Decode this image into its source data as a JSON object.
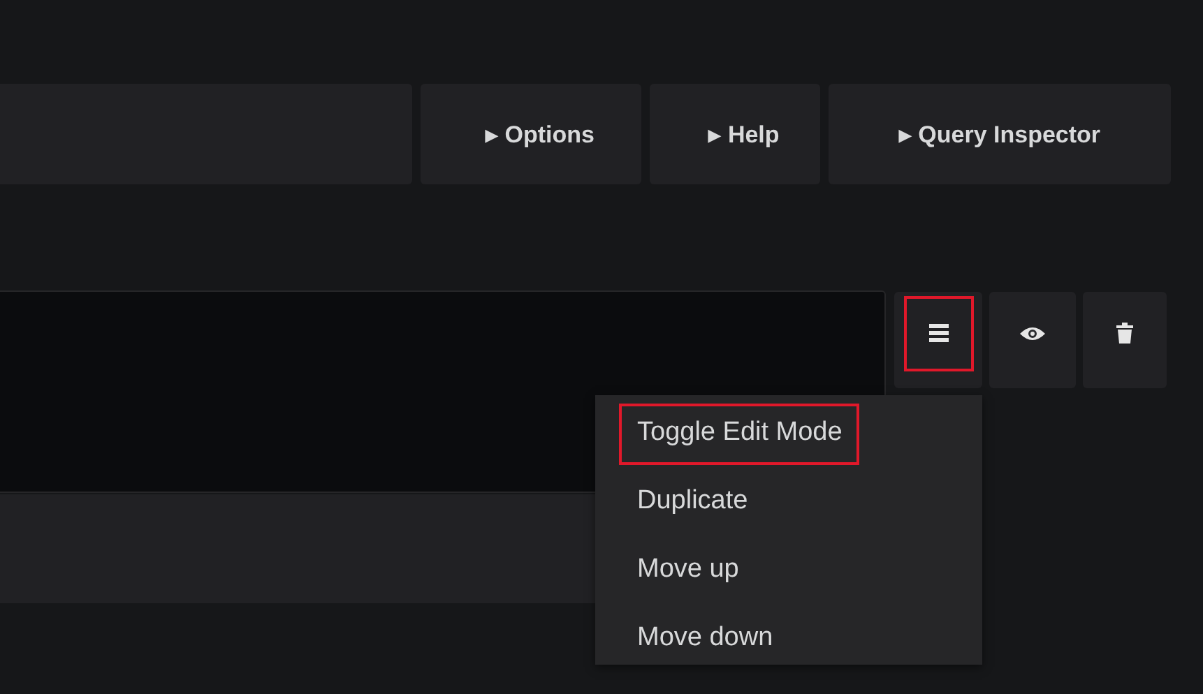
{
  "toolbar": {
    "buttons": [
      {
        "label": "Options",
        "marker": "▸"
      },
      {
        "label": "Help",
        "marker": "▸"
      },
      {
        "label": "Query Inspector",
        "marker": "▸"
      }
    ]
  },
  "row_actions": [
    {
      "kind": "menu",
      "highlighted": true
    },
    {
      "kind": "eye",
      "highlighted": false
    },
    {
      "kind": "trash",
      "highlighted": false
    }
  ],
  "menu": {
    "items": [
      {
        "label": "Toggle Edit Mode",
        "highlighted": true
      },
      {
        "label": "Duplicate",
        "highlighted": false
      },
      {
        "label": "Move up",
        "highlighted": false
      },
      {
        "label": "Move down",
        "highlighted": false
      }
    ]
  }
}
